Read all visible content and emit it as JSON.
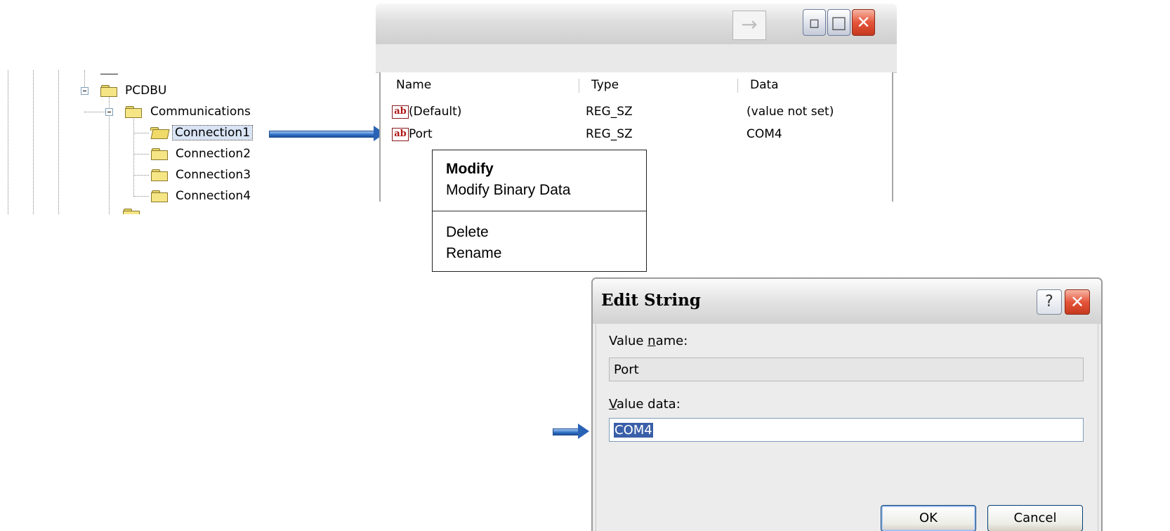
{
  "tree": {
    "nodes": [
      {
        "label": "PCDBU",
        "level": 0,
        "expanded": true
      },
      {
        "label": "Communications",
        "level": 1,
        "expanded": true
      },
      {
        "label": "Connection1",
        "level": 2,
        "selected": true
      },
      {
        "label": "Connection2",
        "level": 2
      },
      {
        "label": "Connection3",
        "level": 2
      },
      {
        "label": "Connection4",
        "level": 2
      }
    ]
  },
  "registry_window": {
    "go_icon": "arrow-right-icon",
    "caption_buttons": [
      "minimize",
      "maximize",
      "close"
    ],
    "columns": {
      "name": "Name",
      "type": "Type",
      "data": "Data"
    },
    "rows": [
      {
        "icon": "ab-string-icon",
        "name": "(Default)",
        "type": "REG_SZ",
        "data": "(value not set)"
      },
      {
        "icon": "ab-string-icon",
        "name": "Port",
        "type": "REG_SZ",
        "data": "COM4"
      }
    ]
  },
  "context_menu": {
    "items": [
      "Modify",
      "Modify Binary Data",
      "Delete",
      "Rename"
    ],
    "default_item": "Modify"
  },
  "edit_string_dialog": {
    "title": "Edit String",
    "help_label": "?",
    "value_name_label": "Value name:",
    "value_name_mnemonic": "n",
    "value_name": "Port",
    "value_data_label": "Value data:",
    "value_data_mnemonic": "V",
    "value_data": "COM4",
    "ok_label": "OK",
    "cancel_label": "Cancel"
  },
  "colors": {
    "arrow": "#2f6fc4",
    "close_button": "#e5553a",
    "selection": "#3a5fa8",
    "folder": "#f6e585"
  }
}
